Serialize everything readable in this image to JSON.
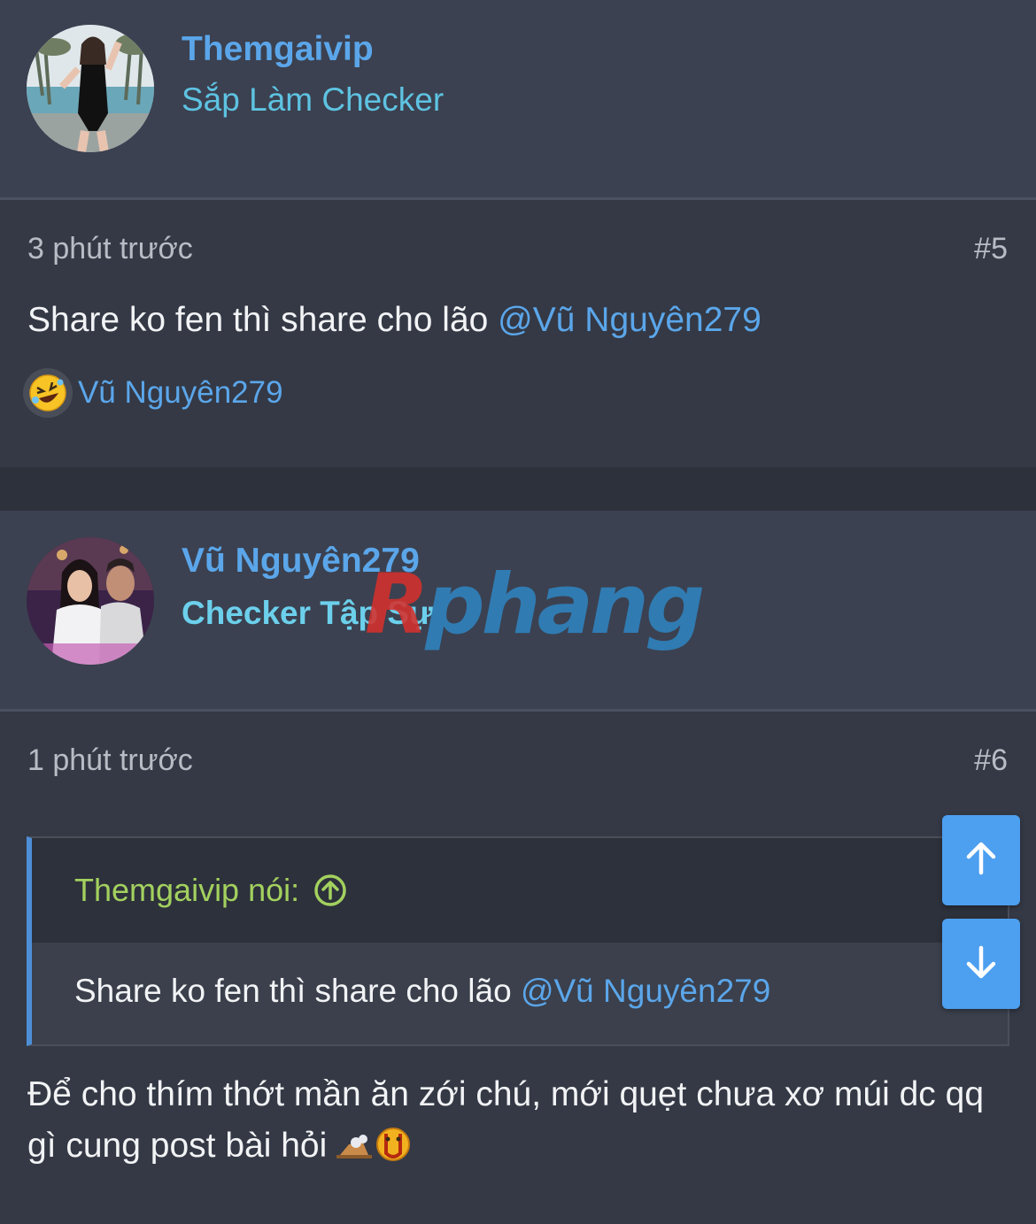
{
  "posts": [
    {
      "username": "Themgaivip",
      "user_title": "Sắp Làm Checker",
      "time": "3 phút trước",
      "post_number": "#5",
      "message_text": "Share ko fen thì share cho lão ",
      "message_mention": "@Vũ Nguyên279",
      "reaction": {
        "emoji": "rolling-on-floor-laughing",
        "user": "Vũ Nguyên279"
      }
    },
    {
      "username": "Vũ Nguyên279",
      "user_title": "Checker Tập Sự",
      "time": "1 phút trước",
      "post_number": "#6",
      "quote": {
        "author": "Themgaivip nói:",
        "text": "Share ko fen thì share cho lão ",
        "mention": "@Vũ Nguyên279"
      },
      "reply_text": "Để cho thím thớt mần ăn zới chú, mới quẹt chưa xơ múi dc qq gì cung post bài hỏi "
    }
  ],
  "watermark": {
    "first": "R",
    "rest": "phang"
  },
  "colors": {
    "background": "#2d313c",
    "header_bg": "#3b4150",
    "body_bg": "#343945",
    "link": "#5ba6ea",
    "quote_author": "#a3d15f",
    "scroll_button": "#4d9ff0"
  },
  "icons": {
    "scroll_up": "arrow-up-icon",
    "scroll_down": "arrow-down-icon",
    "quote_jump": "circle-arrow-up-icon"
  }
}
